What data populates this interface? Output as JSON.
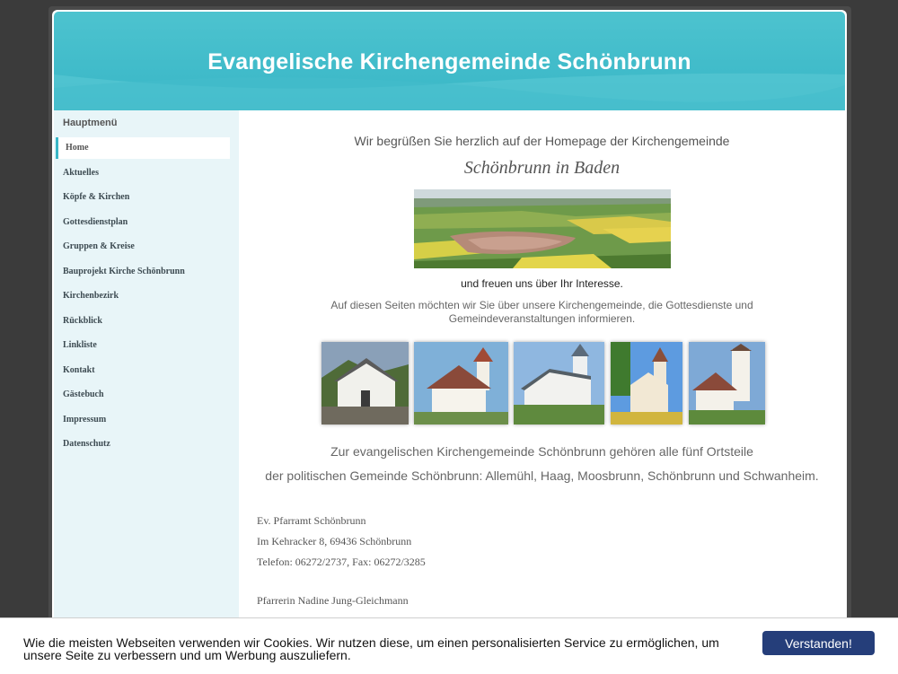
{
  "header": {
    "title": "Evangelische Kirchengemeinde Schönbrunn"
  },
  "sidebar": {
    "heading": "Hauptmenü",
    "items": [
      {
        "label": "Home",
        "active": true
      },
      {
        "label": "Aktuelles"
      },
      {
        "label": "Köpfe & Kirchen"
      },
      {
        "label": "Gottesdienstplan"
      },
      {
        "label": "Gruppen & Kreise"
      },
      {
        "label": "Bauprojekt Kirche Schönbrunn"
      },
      {
        "label": "Kirchenbezirk"
      },
      {
        "label": "Rückblick"
      },
      {
        "label": "Linkliste"
      },
      {
        "label": "Kontakt"
      },
      {
        "label": "Gästebuch"
      },
      {
        "label": "Impressum"
      },
      {
        "label": "Datenschutz"
      }
    ]
  },
  "content": {
    "welcome": "Wir begrüßen Sie herzlich auf der Homepage der Kirchengemeinde",
    "town": "Schönbrunn in Baden",
    "interest": "und freuen uns über Ihr Interesse.",
    "intro": "Auf diesen Seiten möchten wir Sie über unsere Kirchengemeinde, die Gottesdienste und Gemeindeveranstaltungen informieren.",
    "ortsteile_line1": "Zur evangelischen Kirchengemeinde Schönbrunn gehören alle fünf Ortsteile",
    "ortsteile_line2": "der politischen Gemeinde Schönbrunn: Allemühl, Haag, Moosbrunn, Schönbrunn und Schwanheim.",
    "address": {
      "line1": "Ev. Pfarramt Schönbrunn",
      "line2": "Im Kehracker 8, 69436 Schönbrunn",
      "line3": "Telefon: 06272/2737, Fax: 06272/3285"
    },
    "pastor": "Pfarrerin Nadine Jung-Gleichmann"
  },
  "cookie": {
    "text": "Wie die meisten Webseiten verwenden wir Cookies. Wir nutzen diese, um einen personalisierten Service zu ermöglichen, um unsere Seite zu verbessern und um Werbung auszuliefern.",
    "button": "Verstanden!"
  },
  "colors": {
    "header": "#38b6c6",
    "sidebar": "#e8f5f8",
    "cookie_button": "#253e7a"
  }
}
